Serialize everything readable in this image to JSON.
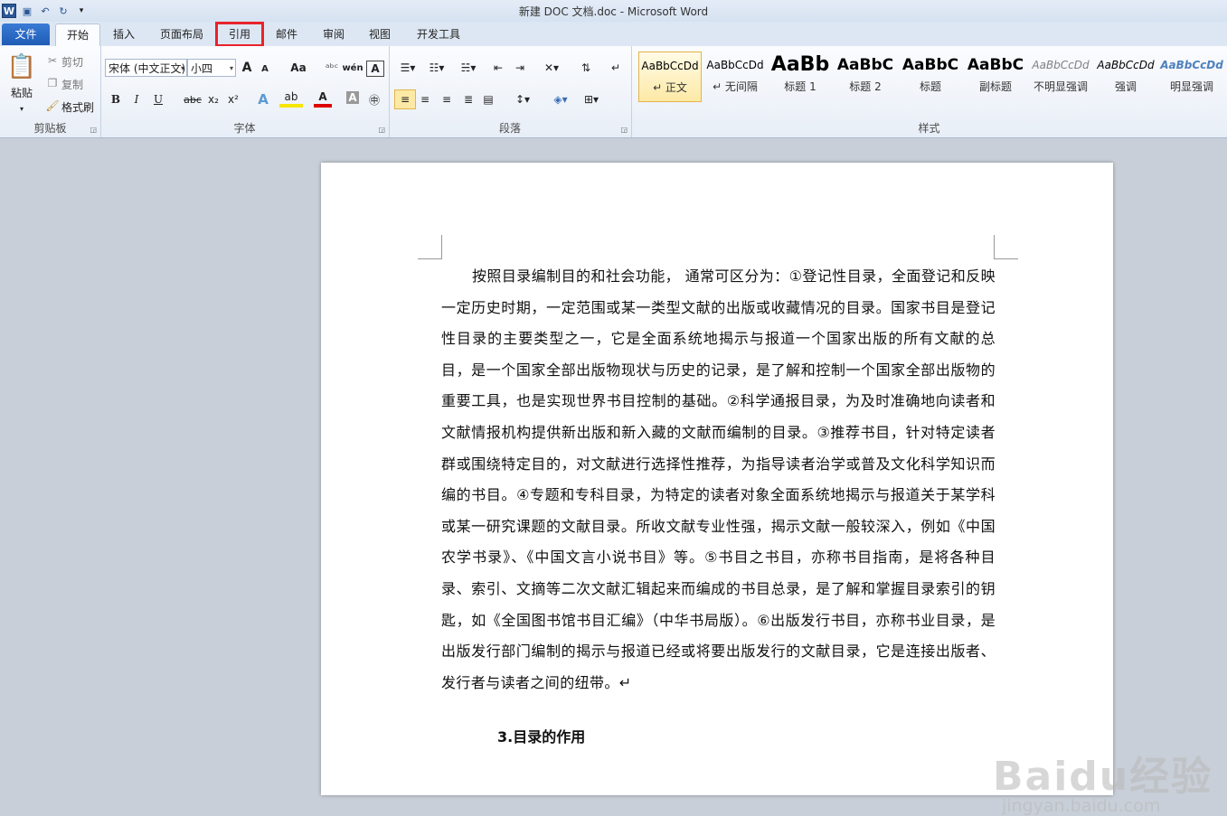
{
  "window": {
    "title": "新建 DOC 文档.doc - Microsoft Word"
  },
  "quick_access": {
    "logo": "W"
  },
  "tabs": [
    {
      "label": "文件"
    },
    {
      "label": "开始"
    },
    {
      "label": "插入"
    },
    {
      "label": "页面布局"
    },
    {
      "label": "引用"
    },
    {
      "label": "邮件"
    },
    {
      "label": "审阅"
    },
    {
      "label": "视图"
    },
    {
      "label": "开发工具"
    }
  ],
  "clipboard": {
    "paste": "粘贴",
    "cut": "剪切",
    "copy": "复制",
    "format_painter": "格式刷",
    "label": "剪贴板"
  },
  "font": {
    "name": "宋体 (中文正文)",
    "size": "小四",
    "label": "字体",
    "grow": "A",
    "shrink": "A",
    "case": "Aa",
    "bold": "B",
    "italic": "I",
    "underline": "U",
    "strike": "abc",
    "sub": "x₂",
    "sup": "x²"
  },
  "paragraph": {
    "label": "段落"
  },
  "styles": {
    "label": "样式",
    "items": [
      {
        "preview": "AaBbCcDd",
        "name": "↵ 正文"
      },
      {
        "preview": "AaBbCcDd",
        "name": "↵ 无间隔"
      },
      {
        "preview": "AaBb",
        "name": "标题 1"
      },
      {
        "preview": "AaBbC",
        "name": "标题 2"
      },
      {
        "preview": "AaBbC",
        "name": "标题"
      },
      {
        "preview": "AaBbC",
        "name": "副标题"
      },
      {
        "preview": "AaBbCcDd",
        "name": "不明显强调"
      },
      {
        "preview": "AaBbCcDd",
        "name": "强调"
      },
      {
        "preview": "AaBbCcDd",
        "name": "明显强调"
      }
    ]
  },
  "document": {
    "body": "按照目录编制目的和社会功能， 通常可区分为：①登记性目录，全面登记和反映一定历史时期，一定范围或某一类型文献的出版或收藏情况的目录。国家书目是登记性目录的主要类型之一，它是全面系统地揭示与报道一个国家出版的所有文献的总目，是一个国家全部出版物现状与历史的记录，是了解和控制一个国家全部出版物的重要工具，也是实现世界书目控制的基础。②科学通报目录，为及时准确地向读者和文献情报机构提供新出版和新入藏的文献而编制的目录。③推荐书目，针对特定读者群或围绕特定目的，对文献进行选择性推荐，为指导读者治学或普及文化科学知识而编的书目。④专题和专科目录，为特定的读者对象全面系统地揭示与报道关于某学科或某一研究课题的文献目录。所收文献专业性强，揭示文献一般较深入，例如《中国农学书录》、《中国文言小说书目》等。⑤书目之书目，亦称书目指南，是将各种目录、索引、文摘等二次文献汇辑起来而编成的书目总录，是了解和掌握目录索引的钥匙，如《全国图书馆书目汇编》（中华书局版）。⑥出版发行书目，亦称书业目录，是出版发行部门编制的揭示与报道已经或将要出版发行的文献目录，它是连接出版者、发行者与读者之间的纽带。↵",
    "next_heading": "3.目录的作用"
  },
  "watermark": {
    "logo": "Baidu经验",
    "sub": "jingyan.baidu.com"
  }
}
